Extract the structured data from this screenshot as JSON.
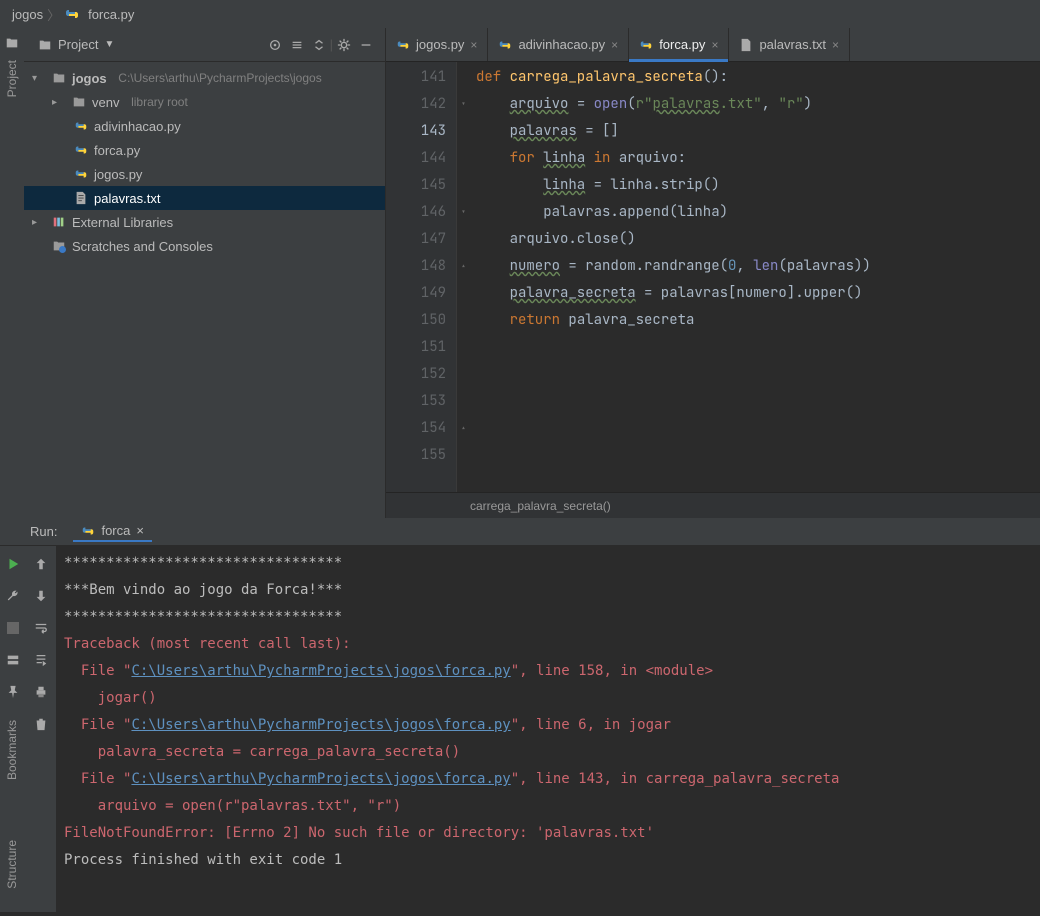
{
  "breadcrumb": {
    "root": "jogos",
    "file": "forca.py"
  },
  "projectPanel": {
    "title": "Project",
    "root": {
      "name": "jogos",
      "path": "C:\\Users\\arthu\\PycharmProjects\\jogos"
    },
    "venv": {
      "name": "venv",
      "hint": "library root"
    },
    "files": [
      "adivinhacao.py",
      "forca.py",
      "jogos.py",
      "palavras.txt"
    ],
    "extLib": "External Libraries",
    "scratches": "Scratches and Consoles"
  },
  "editorTabs": [
    {
      "label": "jogos.py",
      "active": false
    },
    {
      "label": "adivinhacao.py",
      "active": false
    },
    {
      "label": "forca.py",
      "active": true
    },
    {
      "label": "palavras.txt",
      "active": false
    }
  ],
  "code": {
    "startLine": 141,
    "currentLine": 143
  },
  "editorBreadcrumb": "carrega_palavra_secreta()",
  "run": {
    "label": "Run:",
    "tab": "forca",
    "output": {
      "line1": "*********************************",
      "line2": "***Bem vindo ao jogo da Forca!***",
      "line3": "*********************************",
      "trace": "Traceback (most recent call last):",
      "f1a": "  File \"",
      "path": "C:\\Users\\arthu\\PycharmProjects\\jogos\\forca.py",
      "f1b": "\", line 158, in <module>",
      "f1c": "    jogar()",
      "f2b": "\", line 6, in jogar",
      "f2c": "    palavra_secreta = carrega_palavra_secreta()",
      "f3b": "\", line 143, in carrega_palavra_secreta",
      "f3c": "    arquivo = open(r\"palavras.txt\", \"r\")",
      "err": "FileNotFoundError: [Errno 2] No such file or directory: 'palavras.txt'",
      "exit": "Process finished with exit code 1"
    }
  },
  "sideTabs": {
    "project": "Project",
    "bookmarks": "Bookmarks",
    "structure": "Structure"
  }
}
